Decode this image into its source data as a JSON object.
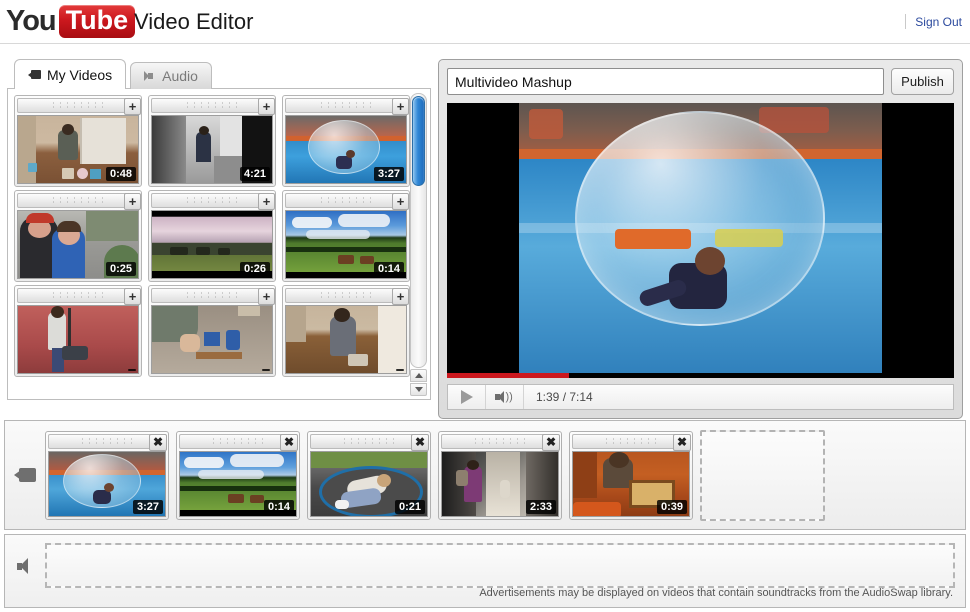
{
  "header": {
    "logo_you": "You",
    "logo_tube": "Tube",
    "app_title": "Video Editor",
    "signout_label": "Sign Out",
    "link_color": "#2c4a9e"
  },
  "tabs": [
    {
      "label": "My Videos",
      "icon": "camcorder-icon",
      "active": true
    },
    {
      "label": "Audio",
      "icon": "speaker-icon",
      "active": false
    }
  ],
  "library": {
    "scroll_position_percent": 8,
    "videos": [
      {
        "duration": "0:48",
        "icon": "add-icon",
        "add_label": "+"
      },
      {
        "duration": "4:21",
        "icon": "add-icon",
        "add_label": "+"
      },
      {
        "duration": "3:27",
        "icon": "add-icon",
        "add_label": "+"
      },
      {
        "duration": "0:25",
        "icon": "add-icon",
        "add_label": "+"
      },
      {
        "duration": "0:26",
        "icon": "add-icon",
        "add_label": "+"
      },
      {
        "duration": "0:14",
        "icon": "add-icon",
        "add_label": "+"
      },
      {
        "duration": "",
        "icon": "add-icon",
        "add_label": "+"
      },
      {
        "duration": "",
        "icon": "add-icon",
        "add_label": "+"
      },
      {
        "duration": "",
        "icon": "add-icon",
        "add_label": "+"
      }
    ]
  },
  "preview": {
    "project_title": "Multivideo Mashup",
    "project_title_placeholder": "Project title",
    "publish_label": "Publish",
    "time_display": "1:39 / 7:14",
    "current_time": "1:39",
    "total_time": "7:14",
    "progress_percent": 24,
    "progress_color": "#cc181e",
    "play_icon": "play-icon",
    "volume_icon": "volume-icon"
  },
  "video_track": {
    "track_icon": "camcorder-icon",
    "clips": [
      {
        "duration": "3:27",
        "remove_label": "✖"
      },
      {
        "duration": "0:14",
        "remove_label": "✖"
      },
      {
        "duration": "0:21",
        "remove_label": "✖"
      },
      {
        "duration": "2:33",
        "remove_label": "✖"
      },
      {
        "duration": "0:39",
        "remove_label": "✖"
      }
    ]
  },
  "audio_track": {
    "track_icon": "speaker-icon",
    "note": "Advertisements may be displayed on videos that contain soundtracks from the AudioSwap library."
  }
}
